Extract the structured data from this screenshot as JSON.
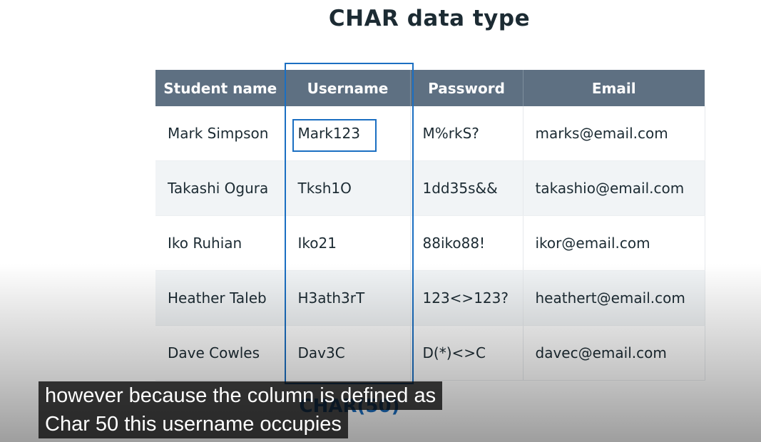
{
  "slide": {
    "title": "CHAR data type",
    "column_type_label": "CHAR(50)"
  },
  "table": {
    "headers": [
      "Student name",
      "Username",
      "Password",
      "Email"
    ],
    "rows": [
      [
        "Mark Simpson",
        "Mark123",
        "M%rkS?",
        "marks@email.com"
      ],
      [
        "Takashi Ogura",
        "Tksh1O",
        "1dd35s&&",
        "takashio@email.com"
      ],
      [
        "Iko Ruhian",
        "Iko21",
        "88iko88!",
        "ikor@email.com"
      ],
      [
        "Heather Taleb",
        "H3ath3rT",
        "123<>123?",
        "heathert@email.com"
      ],
      [
        "Dave Cowles",
        "Dav3C",
        "D(*)<>C",
        "davec@email.com"
      ]
    ]
  },
  "captions": {
    "line1": "however because the column is defined as",
    "line2": "Char 50 this username occupies"
  },
  "colors": {
    "header_bg": "#5e7082",
    "highlight": "#1b6fc2",
    "title_text": "#1c2b33"
  }
}
